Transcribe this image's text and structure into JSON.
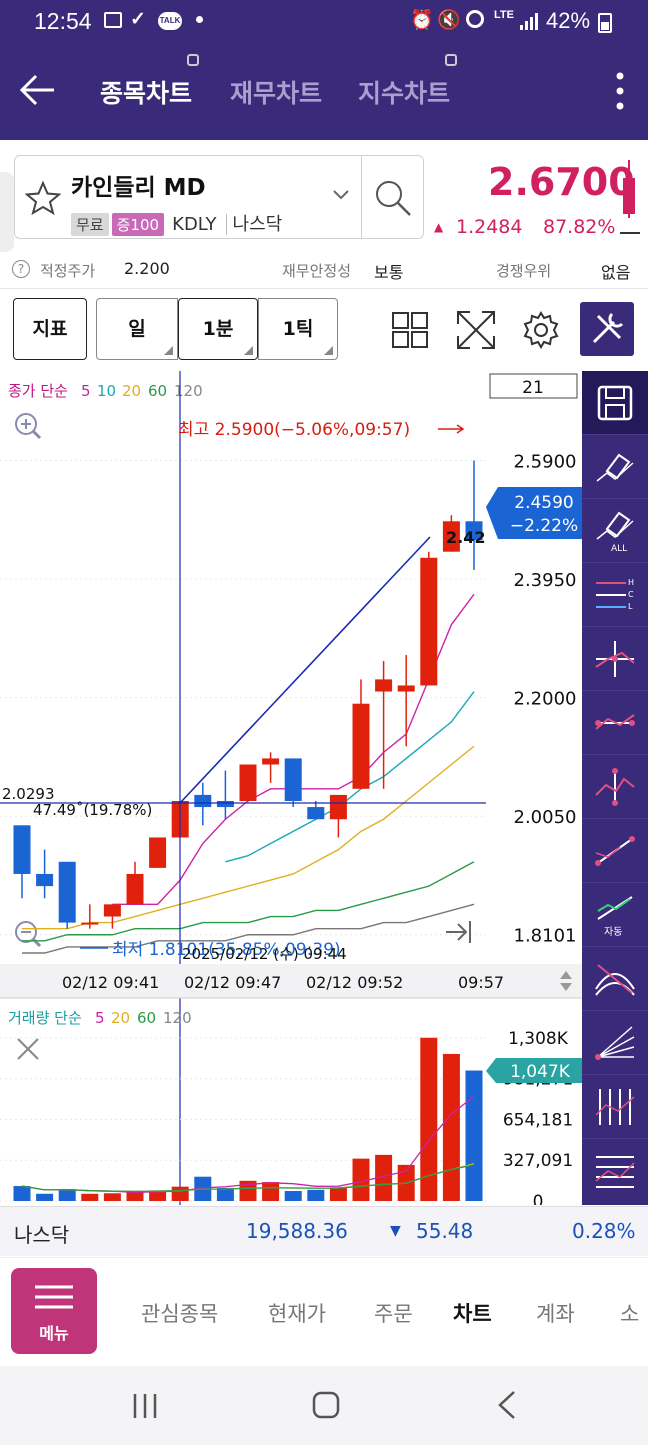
{
  "status": {
    "time": "12:54",
    "battery": "42%",
    "network": "LTE",
    "talk_badge": "TALK"
  },
  "appbar": {
    "tabs": [
      {
        "label": "종목차트",
        "active": true
      },
      {
        "label": "재무차트",
        "active": false
      },
      {
        "label": "지수차트",
        "active": false
      }
    ]
  },
  "stock": {
    "name": "카인들리 MD",
    "badges": [
      "무료",
      "증100"
    ],
    "ticker": "KDLY",
    "market": "나스닥",
    "price": "2.6700",
    "change": "1.2484",
    "change_pct": "87.82%"
  },
  "info": {
    "fair_price_label": "적정주가",
    "fair_price": "2.200",
    "stability_label": "재무안정성",
    "stability": "보통",
    "competition_label": "경쟁우위",
    "competition": "없음"
  },
  "toolbar": {
    "indicator": "지표",
    "period_day": "일",
    "period_min": "1분",
    "period_tick": "1틱"
  },
  "chart_data": [
    {
      "type": "candlestick",
      "legend_prefix": "종가 단순",
      "ma_periods": [
        "5",
        "10",
        "20",
        "60",
        "120"
      ],
      "colors": {
        "up": "#e0220c",
        "down": "#1a64d4",
        "ma5": "#cc22aa",
        "ma10": "#18a8b8",
        "ma20": "#e0b020",
        "ma60": "#2a9a4a",
        "ma120": "#777777"
      },
      "visible_count": "21",
      "ylim": [
        1.78,
        2.65
      ],
      "y_ticks": [
        "2.5900",
        "2.3950",
        "2.2000",
        "2.0050",
        "1.8101"
      ],
      "candles": [
        {
          "o": 1.99,
          "h": 1.99,
          "l": 1.87,
          "c": 1.91
        },
        {
          "o": 1.91,
          "h": 1.95,
          "l": 1.87,
          "c": 1.89
        },
        {
          "o": 1.93,
          "h": 1.93,
          "l": 1.82,
          "c": 1.83
        },
        {
          "o": 1.83,
          "h": 1.86,
          "l": 1.82,
          "c": 1.83
        },
        {
          "o": 1.84,
          "h": 1.86,
          "l": 1.82,
          "c": 1.86
        },
        {
          "o": 1.86,
          "h": 1.93,
          "l": 1.86,
          "c": 1.91
        },
        {
          "o": 1.92,
          "h": 1.97,
          "l": 1.92,
          "c": 1.97
        },
        {
          "o": 1.97,
          "h": 2.03,
          "l": 1.97,
          "c": 2.03
        },
        {
          "o": 2.04,
          "h": 2.06,
          "l": 1.99,
          "c": 2.02
        },
        {
          "o": 2.03,
          "h": 2.08,
          "l": 2.0,
          "c": 2.02
        },
        {
          "o": 2.03,
          "h": 2.09,
          "l": 2.03,
          "c": 2.09
        },
        {
          "o": 2.09,
          "h": 2.11,
          "l": 2.06,
          "c": 2.1
        },
        {
          "o": 2.1,
          "h": 2.1,
          "l": 2.02,
          "c": 2.03
        },
        {
          "o": 2.02,
          "h": 2.03,
          "l": 2.0,
          "c": 2.0
        },
        {
          "o": 2.0,
          "h": 2.04,
          "l": 1.97,
          "c": 2.04
        },
        {
          "o": 2.05,
          "h": 2.23,
          "l": 2.05,
          "c": 2.19
        },
        {
          "o": 2.21,
          "h": 2.26,
          "l": 2.05,
          "c": 2.23
        },
        {
          "o": 2.21,
          "h": 2.27,
          "l": 2.12,
          "c": 2.22
        },
        {
          "o": 2.22,
          "h": 2.44,
          "l": 2.22,
          "c": 2.43
        },
        {
          "o": 2.44,
          "h": 2.5,
          "l": 2.44,
          "c": 2.49
        },
        {
          "o": 2.49,
          "h": 2.59,
          "l": 2.41,
          "c": 2.459
        }
      ],
      "ma5": [
        null,
        null,
        null,
        null,
        1.86,
        1.86,
        1.86,
        1.9,
        1.96,
        2.0,
        2.03,
        2.05,
        2.05,
        2.05,
        2.05,
        2.07,
        2.11,
        2.14,
        2.23,
        2.32,
        2.37
      ],
      "ma10": [
        null,
        null,
        null,
        null,
        null,
        null,
        null,
        null,
        null,
        1.93,
        1.94,
        1.96,
        1.98,
        2.0,
        2.02,
        2.05,
        2.07,
        2.1,
        2.13,
        2.16,
        2.21
      ],
      "ma20": [
        1.82,
        1.82,
        1.82,
        1.83,
        1.83,
        1.84,
        1.85,
        1.86,
        1.87,
        1.88,
        1.89,
        1.9,
        1.91,
        1.93,
        1.95,
        1.98,
        2.0,
        2.03,
        2.06,
        2.09,
        2.12
      ],
      "ma60": [
        1.8,
        1.8,
        1.81,
        1.81,
        1.81,
        1.82,
        1.82,
        1.82,
        1.83,
        1.83,
        1.83,
        1.84,
        1.84,
        1.85,
        1.85,
        1.86,
        1.87,
        1.88,
        1.89,
        1.91,
        1.93
      ],
      "ma120": [
        1.78,
        1.78,
        1.79,
        1.79,
        1.79,
        1.79,
        1.8,
        1.8,
        1.8,
        1.8,
        1.81,
        1.81,
        1.81,
        1.82,
        1.82,
        1.82,
        1.83,
        1.83,
        1.84,
        1.85,
        1.86
      ],
      "high_label": "최고 2.5900(−5.06%,09:57)",
      "low_label": "최저 1.8101(35.85%,09:39)",
      "current_price": "2.4590",
      "current_pct": "−2.22%",
      "prev_value": "2.42",
      "crosshair_value": "2.0293",
      "crosshair_time": "2025/02/12 (수) 09:44",
      "angle_label": "47.49˚(19.78%)",
      "x_labels": [
        "02/12 09:41",
        "02/12 09:47",
        "02/12 09:52",
        "09:57"
      ]
    },
    {
      "type": "bar",
      "legend_prefix": "거래량 단순",
      "ma_periods": [
        "5",
        "20",
        "60",
        "120"
      ],
      "ylim": [
        0,
        1308000
      ],
      "y_ticks": [
        "1,308K",
        "981,271",
        "654,181",
        "327,091",
        "0"
      ],
      "current_volume": "1,047K",
      "values": [
        120000,
        58000,
        95000,
        58000,
        62000,
        72000,
        85000,
        115000,
        195000,
        105000,
        162000,
        152000,
        80000,
        90000,
        110000,
        340000,
        370000,
        290000,
        1310000,
        1180000,
        1047000
      ]
    }
  ],
  "index_bar": {
    "name": "나스닥",
    "value": "19,588.36",
    "change": "55.48",
    "pct": "0.28%"
  },
  "bottom_nav": {
    "menu": "메뉴",
    "items": [
      "관심종목",
      "현재가",
      "주문",
      "차트",
      "계좌",
      "소"
    ],
    "active": "차트"
  }
}
